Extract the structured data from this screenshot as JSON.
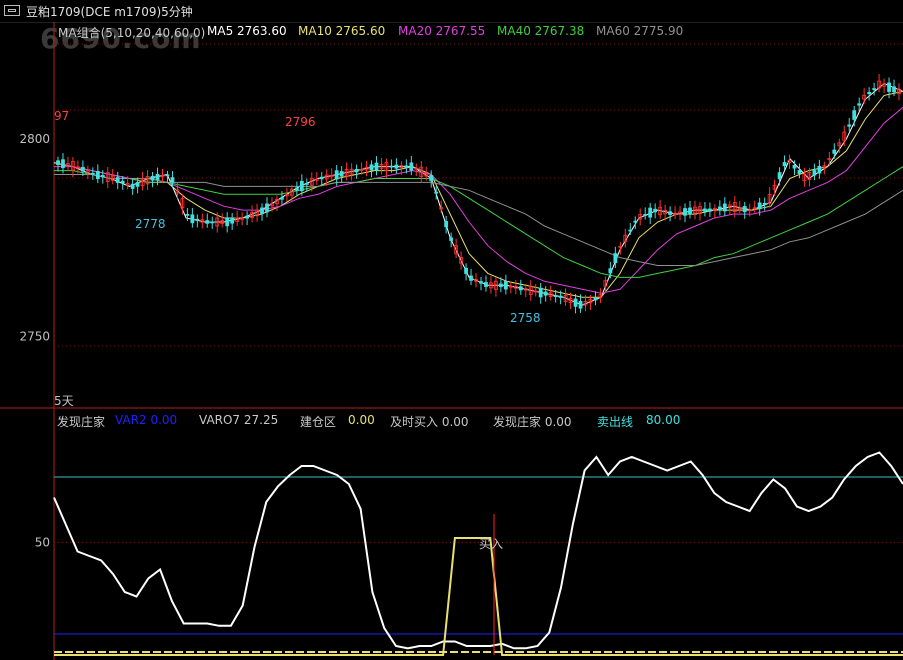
{
  "window": {
    "title": "豆粕1709(DCE m1709)5分钟"
  },
  "watermark": "6690.com",
  "main_legend": [
    {
      "label": "MA组合(5,10,20,40,60,0)",
      "color": "#c8c8c8"
    },
    {
      "label": "MA5 2763.60",
      "color": "#ffffff"
    },
    {
      "label": "MA10 2765.60",
      "color": "#e8e070"
    },
    {
      "label": "MA20 2767.55",
      "color": "#e040e0"
    },
    {
      "label": "MA40 2767.38",
      "color": "#40d040"
    },
    {
      "label": "MA60 2775.90",
      "color": "#909090"
    }
  ],
  "sub_legend": [
    {
      "label": "发现庄家",
      "color": "#c8c8c8"
    },
    {
      "label": "VAR2 0.00",
      "color": "#2020ff"
    },
    {
      "label": "VARO7 27.25",
      "color": "#c8c8c8"
    },
    {
      "label": "建仓区",
      "color": "#c8c8c8"
    },
    {
      "label": "0.00",
      "color": "#e8e070"
    },
    {
      "label": "及时买入 0.00",
      "color": "#c8c8c8"
    },
    {
      "label": "发现庄家 0.00",
      "color": "#c8c8c8"
    },
    {
      "label": "卖出线",
      "color": "#40e0e0"
    },
    {
      "label": "80.00",
      "color": "#40e0e0"
    }
  ],
  "period_label": "5天",
  "chart_data": [
    {
      "type": "line",
      "title": "豆粕1709(DCE m1709)5分钟",
      "yticks": [
        2800,
        2750
      ],
      "ylim": [
        2733,
        2825
      ],
      "annotations": [
        {
          "text": "97",
          "value": 2797,
          "color": "#ff4040"
        },
        {
          "text": "2796",
          "value": 2796,
          "color": "#ff4040"
        },
        {
          "text": "2778",
          "value": 2778,
          "color": "#40c0e0"
        },
        {
          "text": "2758",
          "value": 2758,
          "color": "#40c0e0"
        }
      ],
      "series": [
        {
          "name": "MA5",
          "color": "#ffffff",
          "values": [
            2794,
            2793,
            2791,
            2790,
            2788,
            2790,
            2791,
            2780,
            2779,
            2779,
            2780,
            2782,
            2785,
            2788,
            2790,
            2791,
            2792,
            2793,
            2793,
            2793,
            2790,
            2775,
            2765,
            2763,
            2763,
            2762,
            2761,
            2760,
            2758,
            2760,
            2772,
            2780,
            2782,
            2781,
            2782,
            2782,
            2783,
            2782,
            2784,
            2795,
            2790,
            2793,
            2800,
            2810,
            2814,
            2812
          ]
        },
        {
          "name": "MA10",
          "color": "#e8e070",
          "values": [
            2794,
            2793,
            2792,
            2791,
            2790,
            2789,
            2789,
            2785,
            2782,
            2780,
            2780,
            2781,
            2783,
            2786,
            2788,
            2790,
            2791,
            2792,
            2792,
            2793,
            2791,
            2781,
            2771,
            2766,
            2764,
            2763,
            2762,
            2761,
            2760,
            2760,
            2766,
            2775,
            2779,
            2781,
            2781,
            2782,
            2782,
            2782,
            2783,
            2790,
            2792,
            2793,
            2797,
            2805,
            2811,
            2812
          ]
        },
        {
          "name": "MA20",
          "color": "#e040e0",
          "values": [
            2793,
            2793,
            2792,
            2791,
            2790,
            2789,
            2789,
            2787,
            2785,
            2783,
            2782,
            2782,
            2783,
            2785,
            2786,
            2788,
            2789,
            2790,
            2791,
            2792,
            2791,
            2786,
            2779,
            2773,
            2769,
            2766,
            2764,
            2763,
            2762,
            2761,
            2762,
            2767,
            2772,
            2776,
            2778,
            2780,
            2781,
            2781,
            2782,
            2785,
            2787,
            2789,
            2792,
            2798,
            2804,
            2808
          ]
        },
        {
          "name": "MA40",
          "color": "#40d040",
          "values": [
            2792,
            2792,
            2791,
            2790,
            2790,
            2789,
            2789,
            2788,
            2787,
            2786,
            2786,
            2786,
            2786,
            2787,
            2788,
            2789,
            2789,
            2790,
            2790,
            2790,
            2790,
            2788,
            2785,
            2782,
            2779,
            2776,
            2773,
            2770,
            2768,
            2766,
            2765,
            2765,
            2766,
            2767,
            2768,
            2770,
            2771,
            2773,
            2775,
            2777,
            2779,
            2781,
            2784,
            2787,
            2790,
            2793
          ]
        },
        {
          "name": "MA60",
          "color": "#909090",
          "values": [
            2791,
            2791,
            2791,
            2790,
            2790,
            2790,
            2789,
            2789,
            2789,
            2788,
            2788,
            2788,
            2788,
            2788,
            2788,
            2789,
            2789,
            2789,
            2789,
            2789,
            2789,
            2788,
            2787,
            2785,
            2783,
            2781,
            2778,
            2776,
            2774,
            2772,
            2770,
            2769,
            2768,
            2768,
            2768,
            2769,
            2770,
            2771,
            2772,
            2774,
            2775,
            2777,
            2779,
            2781,
            2784,
            2787
          ]
        }
      ]
    },
    {
      "type": "line",
      "yticks": [
        50
      ],
      "ylim": [
        0,
        100
      ],
      "sell_line": 80,
      "var2": 0,
      "annotations": [
        {
          "text": "买入",
          "color": "#c8c8c8"
        }
      ],
      "series": [
        {
          "name": "VARO7",
          "color": "#ffffff",
          "values": [
            70,
            58,
            46,
            44,
            42,
            36,
            28,
            26,
            34,
            38,
            24,
            14,
            14,
            14,
            13,
            13,
            22,
            48,
            68,
            75,
            80,
            84,
            84,
            82,
            80,
            76,
            65,
            28,
            12,
            4,
            3,
            4,
            4,
            6,
            6,
            4,
            4,
            4,
            5,
            3,
            3,
            4,
            10,
            30,
            58,
            82,
            88,
            80,
            86,
            88,
            86,
            84,
            82,
            84,
            86,
            80,
            72,
            68,
            66,
            64,
            72,
            78,
            74,
            66,
            64,
            66,
            70,
            78,
            84,
            88,
            90,
            84,
            76
          ]
        },
        {
          "name": "建仓区",
          "color": "#e8e070",
          "values": [
            0,
            0,
            0,
            0,
            0,
            0,
            0,
            0,
            0,
            0,
            0,
            0,
            0,
            0,
            0,
            0,
            0,
            0,
            0,
            0,
            0,
            0,
            0,
            0,
            0,
            0,
            0,
            0,
            0,
            0,
            0,
            0,
            0,
            0,
            52,
            52,
            52,
            52,
            0,
            0,
            0,
            0,
            0,
            0,
            0,
            0,
            0,
            0,
            0,
            0,
            0,
            0,
            0,
            0,
            0,
            0,
            0,
            0,
            0,
            0,
            0,
            0,
            0,
            0,
            0,
            0,
            0,
            0,
            0,
            0,
            0,
            0,
            0
          ]
        }
      ]
    }
  ]
}
